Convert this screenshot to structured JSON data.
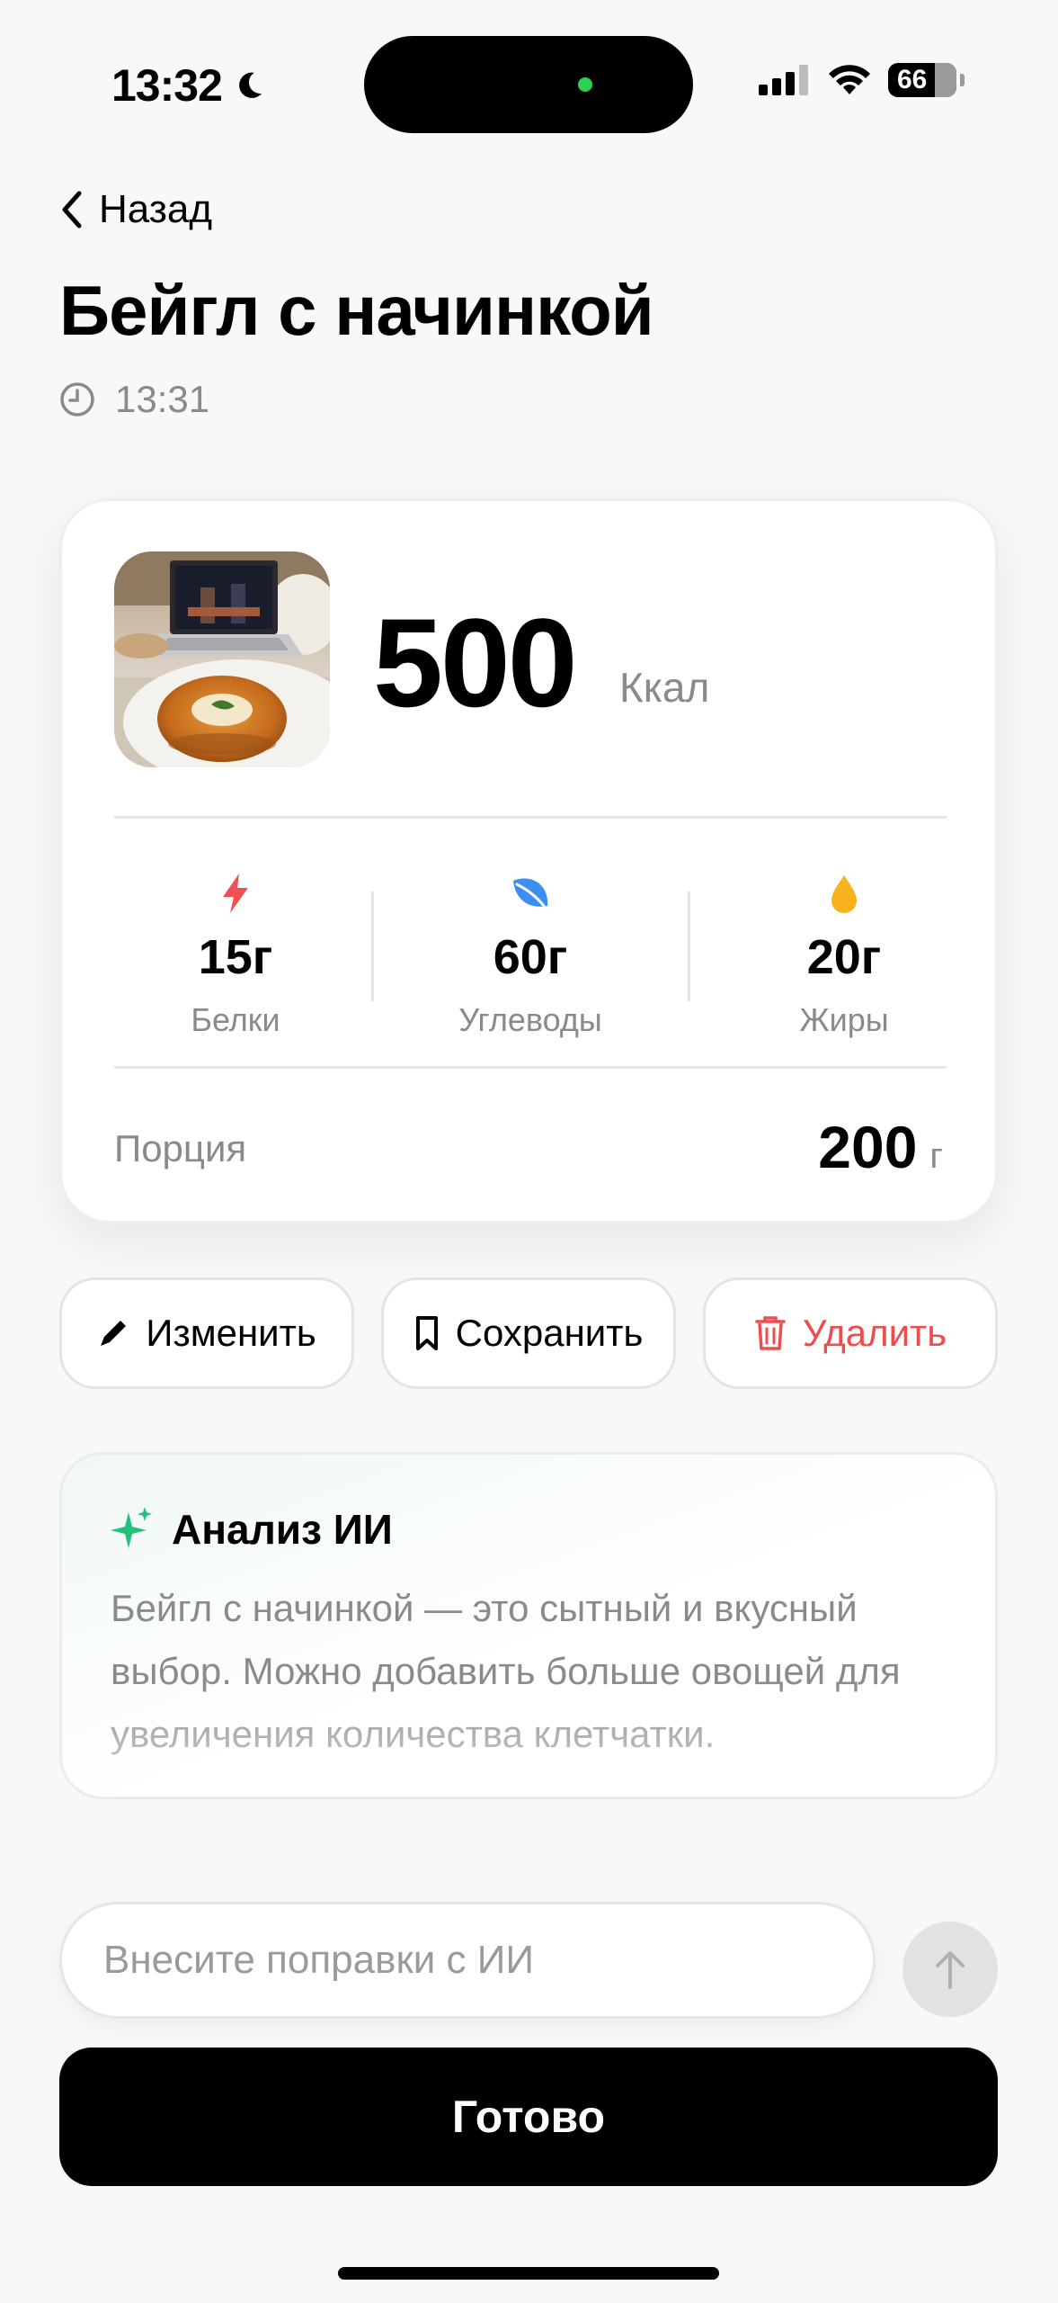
{
  "status_bar": {
    "time": "13:32",
    "battery": "66",
    "battery_level": 0.66
  },
  "header": {
    "back_label": "Назад",
    "title": "Бейгл с начинкой",
    "time": "13:31"
  },
  "nutrition": {
    "calories": "500",
    "calories_unit": "Ккал",
    "macros": [
      {
        "value": "15г",
        "label": "Белки",
        "icon": "lightning-icon",
        "color": "#f0504f"
      },
      {
        "value": "60г",
        "label": "Углеводы",
        "icon": "leaf-icon",
        "color": "#3b8ff0"
      },
      {
        "value": "20г",
        "label": "Жиры",
        "icon": "drop-icon",
        "color": "#f7b21c"
      }
    ],
    "portion_label": "Порция",
    "portion_value": "200",
    "portion_unit": "г"
  },
  "actions": {
    "edit_label": "Изменить",
    "save_label": "Сохранить",
    "delete_label": "Удалить"
  },
  "ai_analysis": {
    "title": "Анализ ИИ",
    "text": "Бейгл с начинкой — это сытный и вкусный выбор. Можно добавить больше овощей для увеличения количества клетчатки.",
    "accent": "#22c07a"
  },
  "input": {
    "placeholder": "Внесите поправки с ИИ",
    "value": ""
  },
  "done_label": "Готово",
  "colors": {
    "danger": "#ee4d4d",
    "background": "#f7f8fa"
  }
}
